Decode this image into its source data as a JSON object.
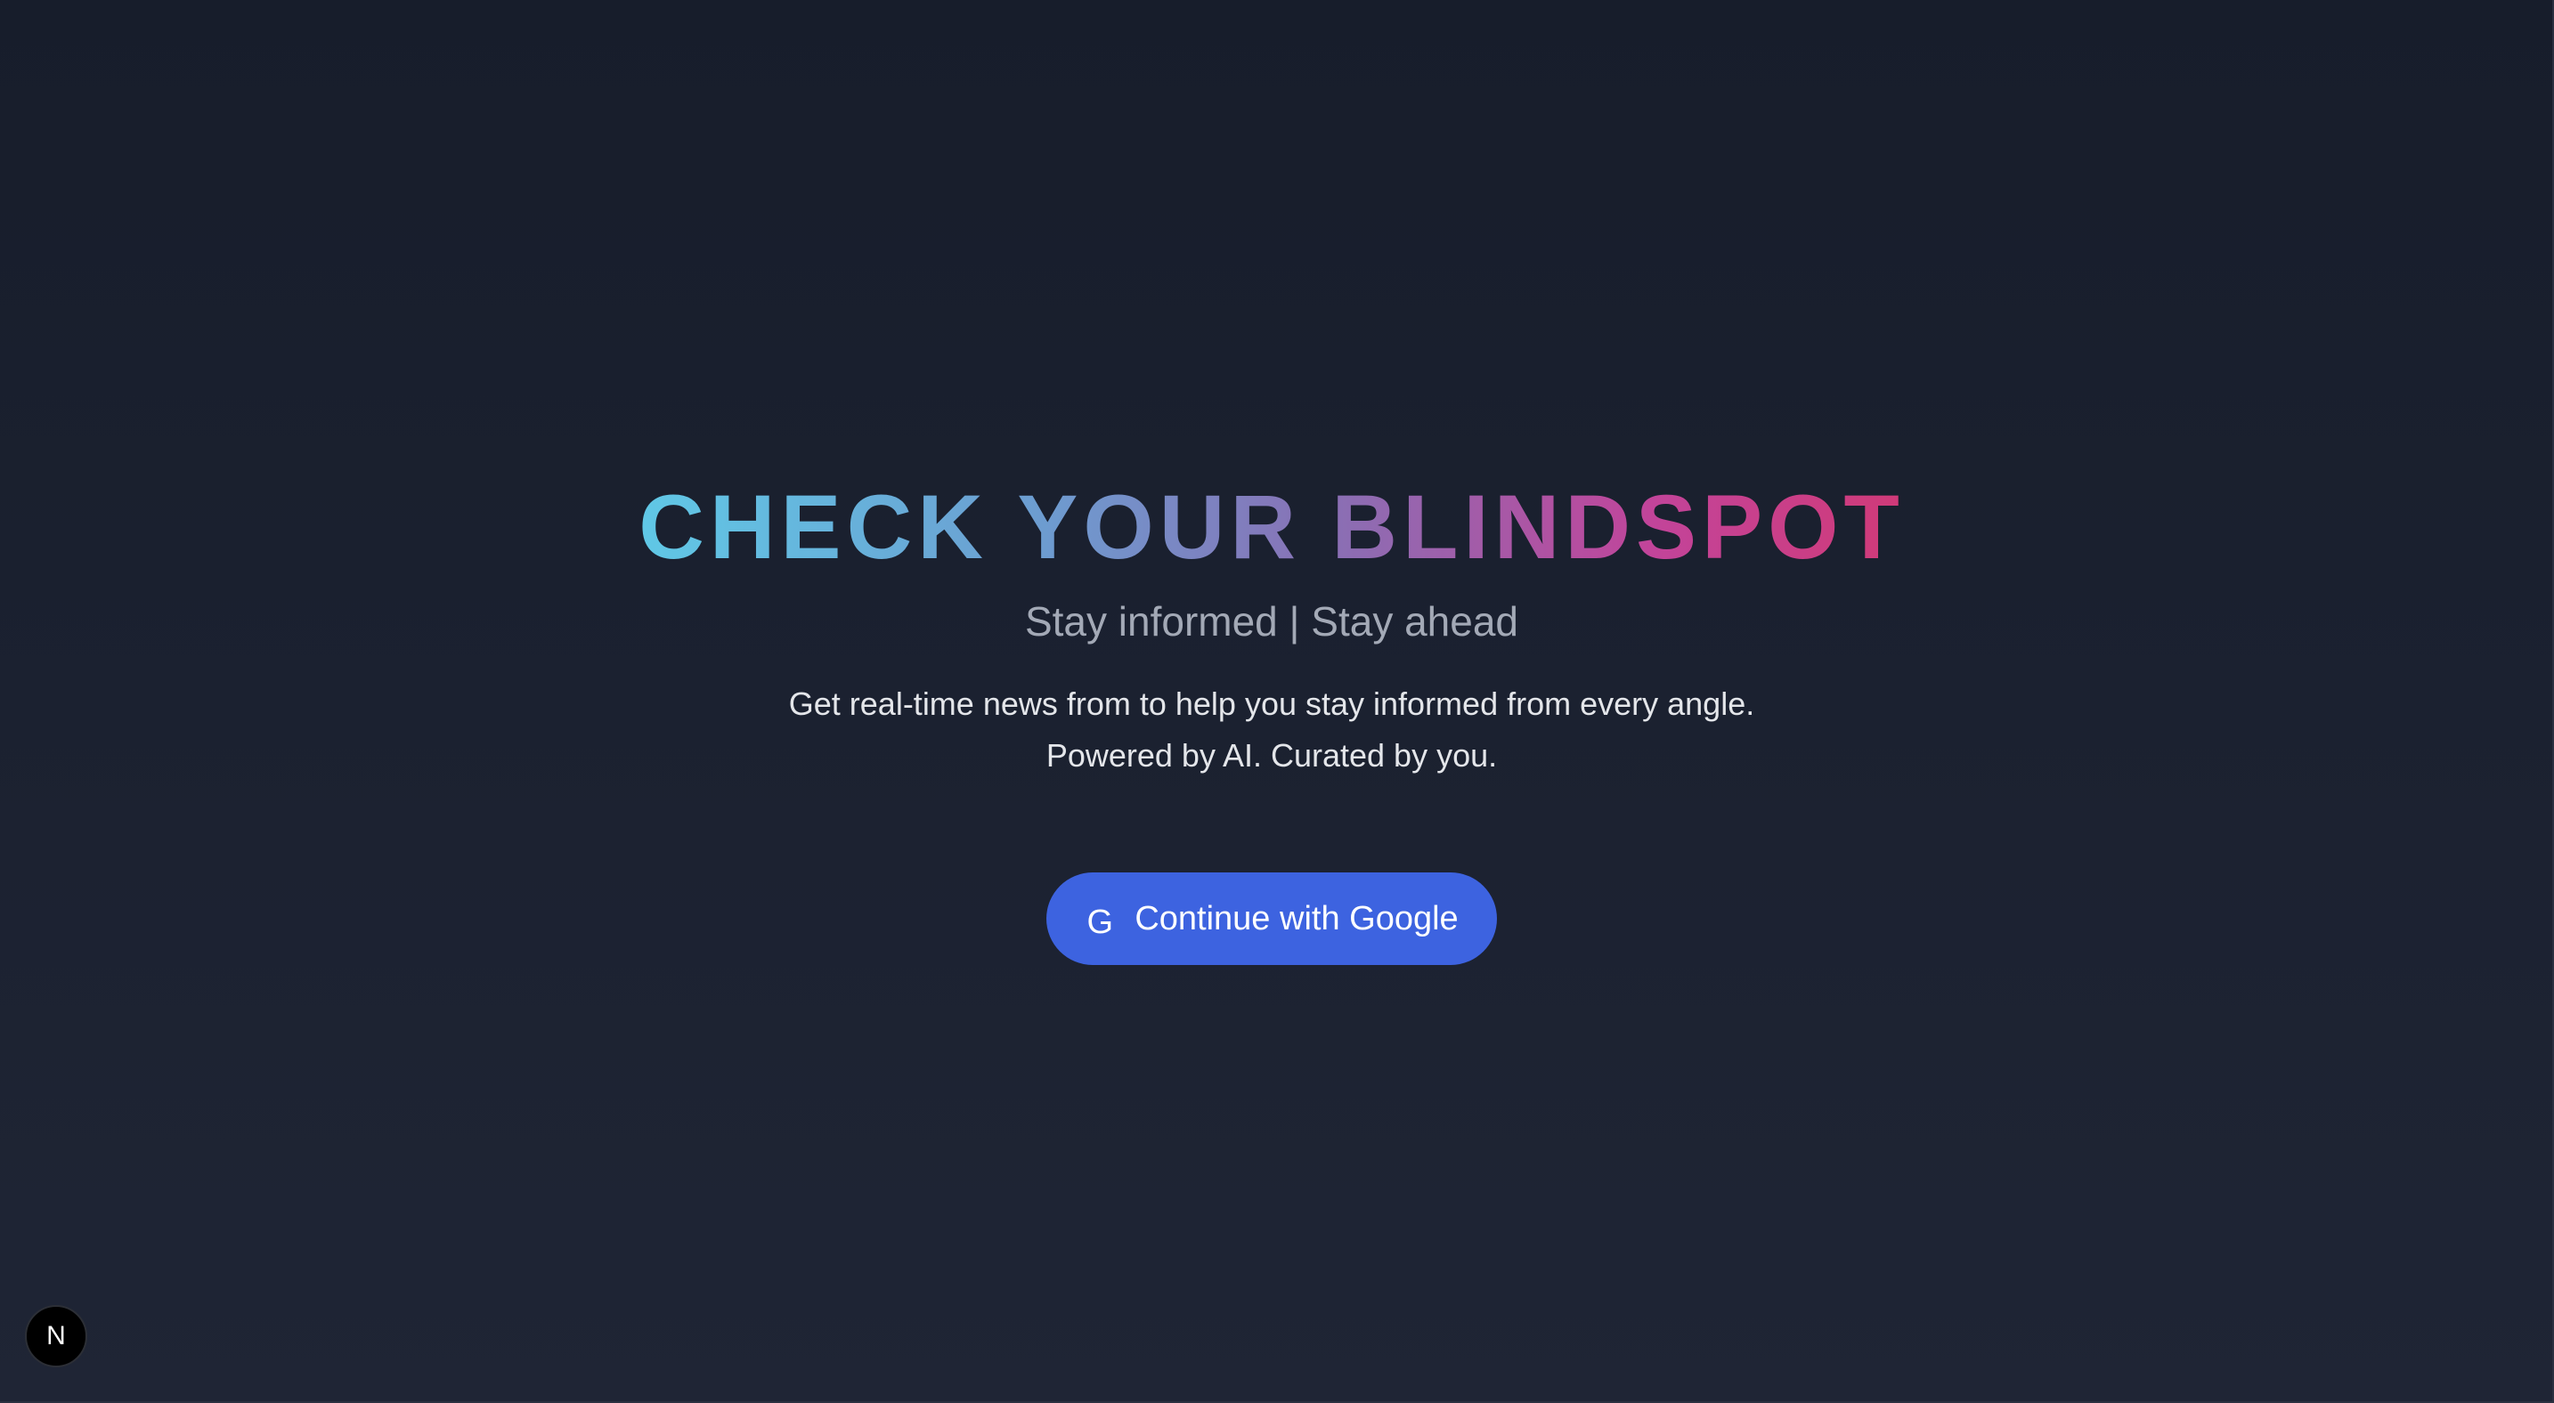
{
  "hero": {
    "title": "CHECK YOUR BLINDSPOT",
    "subtitle": "Stay informed | Stay ahead",
    "description_line1": "Get real-time news from to help you stay informed from every angle.",
    "description_line2": "Powered by AI. Curated by you."
  },
  "auth": {
    "google_icon": "G",
    "google_button_label": "Continue with Google"
  },
  "devtools": {
    "badge_letter": "N"
  },
  "colors": {
    "background": "#1b2130",
    "title_gradient_start": "#60c8e6",
    "title_gradient_mid": "#8a6fb4",
    "title_gradient_end": "#d03a78",
    "button_bg": "#3d63e0",
    "subtitle": "#a3a9b6",
    "description": "#e4e6ea"
  },
  "icons": {
    "google": "google-icon",
    "nextjs": "nextjs-icon"
  }
}
